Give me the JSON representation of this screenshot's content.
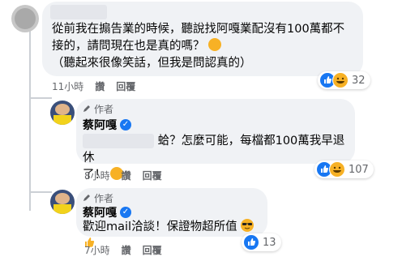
{
  "comments": [
    {
      "lines": [
        "從前我在搧告業的時候，聽說找阿嘎業配沒有100萬都不",
        "接的，請問現在也是真的嗎？",
        "（聽起來很像笑話，但我是問認真的）"
      ],
      "time": "11小時",
      "actions": [
        "讚",
        "回覆"
      ],
      "reaction_count": "32"
    },
    {
      "author_tag": "作者",
      "name": "蔡阿嘎",
      "lines": [
        "蛤？怎麼可能，每檔都100萬我早退休",
        "了！"
      ],
      "time": "8小時",
      "actions": [
        "讚",
        "回覆"
      ],
      "reaction_count": "107"
    },
    {
      "author_tag": "作者",
      "name": "蔡阿嘎",
      "lines": [
        "歡迎mail洽談！保證物超所值"
      ],
      "time": "7小時",
      "actions": [
        "讚",
        "回覆"
      ],
      "reaction_count": "13"
    }
  ],
  "colors": {
    "like_blue": "#1877f2",
    "bubble_bg": "#f0f2f5",
    "meta_gray": "#65676b",
    "haha_yellow": "#f7b125"
  },
  "icons": [
    "pencil-icon",
    "verified-badge-icon",
    "like-reaction-icon",
    "haha-reaction-icon",
    "cool-emoji-icon",
    "thumbs-up-emoji-icon"
  ]
}
